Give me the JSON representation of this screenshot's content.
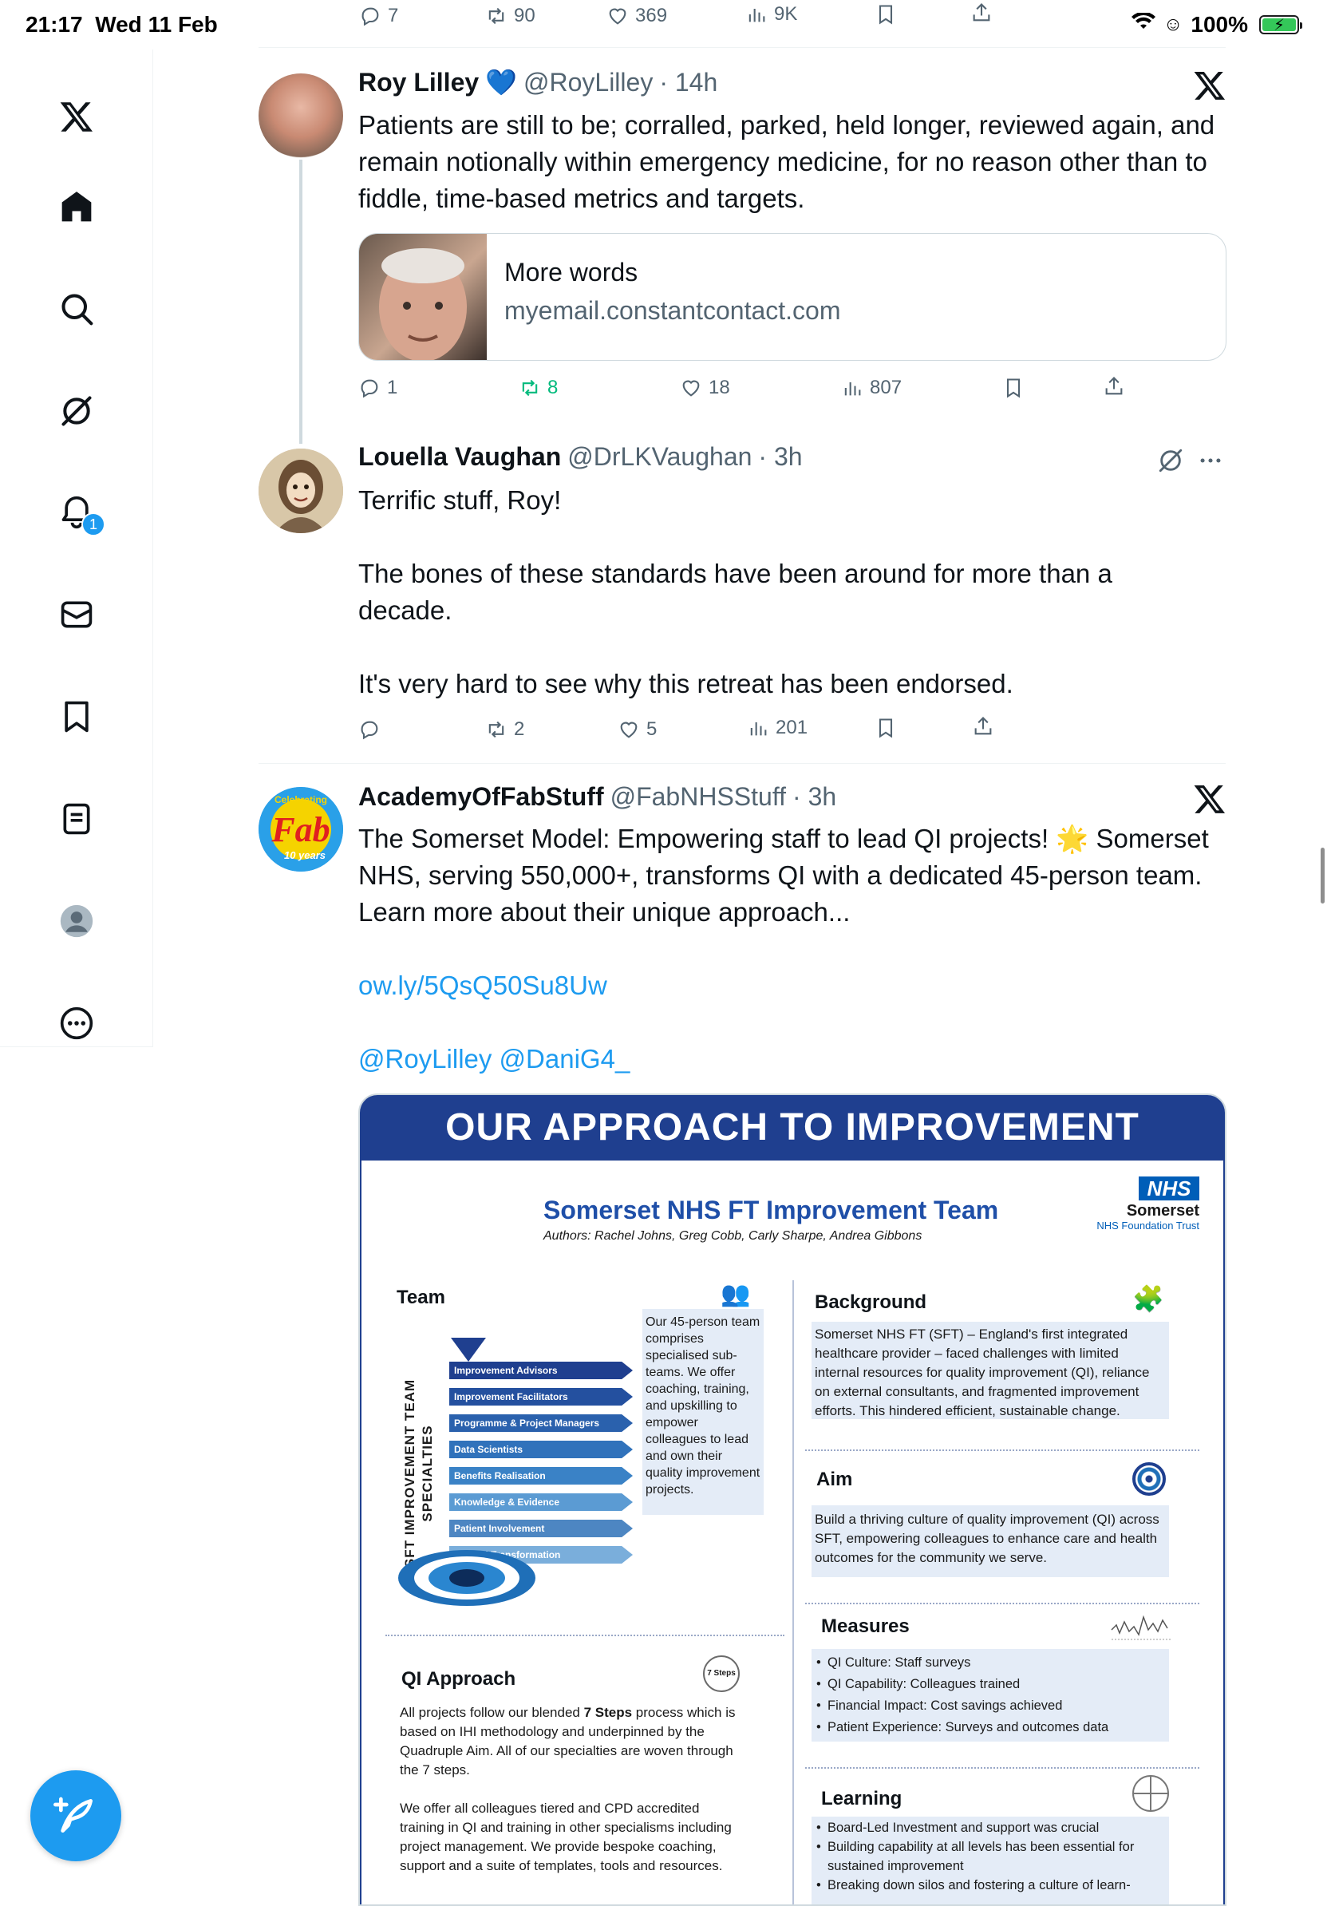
{
  "status_bar": {
    "time": "21:17",
    "date": "Wed 11 Feb",
    "battery": "100%"
  },
  "colors": {
    "accent": "#1d9bf0",
    "text": "#0f1419",
    "muted": "#536471",
    "retweet_green": "#00ba7c",
    "poster_blue": "#1f3f8f"
  },
  "sidebar": {
    "items": [
      {
        "name": "x-logo-icon"
      },
      {
        "name": "home-icon"
      },
      {
        "name": "search-icon"
      },
      {
        "name": "grok-icon"
      },
      {
        "name": "notifications-icon"
      },
      {
        "name": "messages-icon"
      },
      {
        "name": "bookmarks-icon"
      },
      {
        "name": "lists-icon"
      },
      {
        "name": "profile-icon"
      },
      {
        "name": "more-icon"
      }
    ],
    "notification_count": "1",
    "compose_icon": "compose-icon"
  },
  "top_stats": {
    "replies": "7",
    "reposts": "90",
    "likes": "369",
    "views": "9K"
  },
  "tweets": [
    {
      "name": "Roy Lilley",
      "verified": "💙",
      "handle": "@RoyLilley",
      "time": "· 14h",
      "text": "Patients are still to be; corralled, parked, held longer, reviewed again, and remain notionally within emergency medicine, for no reason other than to fiddle, time-based metrics and targets.",
      "card": {
        "title": "More words",
        "domain": "myemail.constantcontact.com"
      },
      "stats": {
        "replies": "1",
        "reposts": "8",
        "likes": "18",
        "views": "807"
      }
    },
    {
      "name": "Louella Vaughan",
      "handle": "@DrLKVaughan",
      "time": "· 3h",
      "text_p1": "Terrific stuff, Roy!",
      "text_p2": "The bones of these standards have been around for more than a decade.",
      "text_p3": "It's very hard to see why this retreat has been endorsed.",
      "stats": {
        "replies": "",
        "reposts": "2",
        "likes": "5",
        "views": "201"
      }
    },
    {
      "name": "AcademyOfFabStuff",
      "handle": "@FabNHSStuff",
      "time": "· 3h",
      "text": "The Somerset Model: Empowering staff to lead QI projects! 🌟 Somerset NHS, serving 550,000+, transforms QI with a dedicated 45-person team. Learn more about their unique approach...",
      "link": "ow.ly/5QsQ50Su8Uw",
      "mentions": "@RoyLilley @DaniG4_",
      "avatar_text": {
        "line1": "Celebrating",
        "line2": "Fab",
        "line3": "10 years"
      }
    }
  ],
  "poster": {
    "header": "OUR APPROACH TO IMPROVEMENT",
    "nhs_logo": "NHS",
    "org": "Somerset",
    "org_sub": "NHS Foundation Trust",
    "title": "Somerset NHS FT Improvement Team",
    "authors": "Authors: Rachel Johns, Greg Cobb, Carly Sharpe, Andrea Gibbons",
    "team": {
      "heading": "Team",
      "vertical_label": "SFT IMPROVEMENT TEAM SPECIALTIES",
      "specialties": [
        "Improvement Advisors",
        "Improvement Facilitators",
        "Programme & Project Managers",
        "Data Scientists",
        "Benefits Realisation",
        "Knowledge & Evidence",
        "Patient Involvement",
        "Clinical Transformation"
      ],
      "description": "Our 45-person team comprises specialised sub-teams. We offer coaching, training, and upskilling to empower colleagues to lead and own their quality improvement projects."
    },
    "background": {
      "heading": "Background",
      "text": "Somerset NHS FT (SFT) – England's first integrated healthcare provider – faced challenges with limited internal resources for quality improvement (QI), reliance on external consultants, and fragmented improvement efforts. This hindered efficient, sustainable change."
    },
    "aim": {
      "heading": "Aim",
      "text": "Build a thriving culture of quality improvement (QI) across SFT, empowering colleagues to enhance care and health outcomes for the community we serve."
    },
    "measures": {
      "heading": "Measures",
      "items": [
        "QI Culture: Staff surveys",
        "QI Capability: Colleagues trained",
        "Financial Impact: Cost savings achieved",
        "Patient Experience: Surveys and outcomes data"
      ]
    },
    "qi_approach": {
      "heading": "QI Approach",
      "p1_a": "All projects follow our blended ",
      "p1_b": "7 Steps",
      "p1_c": " process which is based on IHI methodology and underpinned by the Quadruple Aim. All of our specialties are woven through the 7 steps.",
      "p2": "We offer all colleagues tiered and CPD accredited training in QI and training in other specialisms including project management. We provide bespoke coaching, support and a suite of templates, tools and resources.",
      "badge": "7 Steps"
    },
    "learning": {
      "heading": "Learning",
      "items": [
        "Board-Led Investment and support was crucial",
        "Building capability at all levels has been essential for sustained improvement",
        "Breaking down silos and fostering a culture of learn-"
      ]
    }
  }
}
